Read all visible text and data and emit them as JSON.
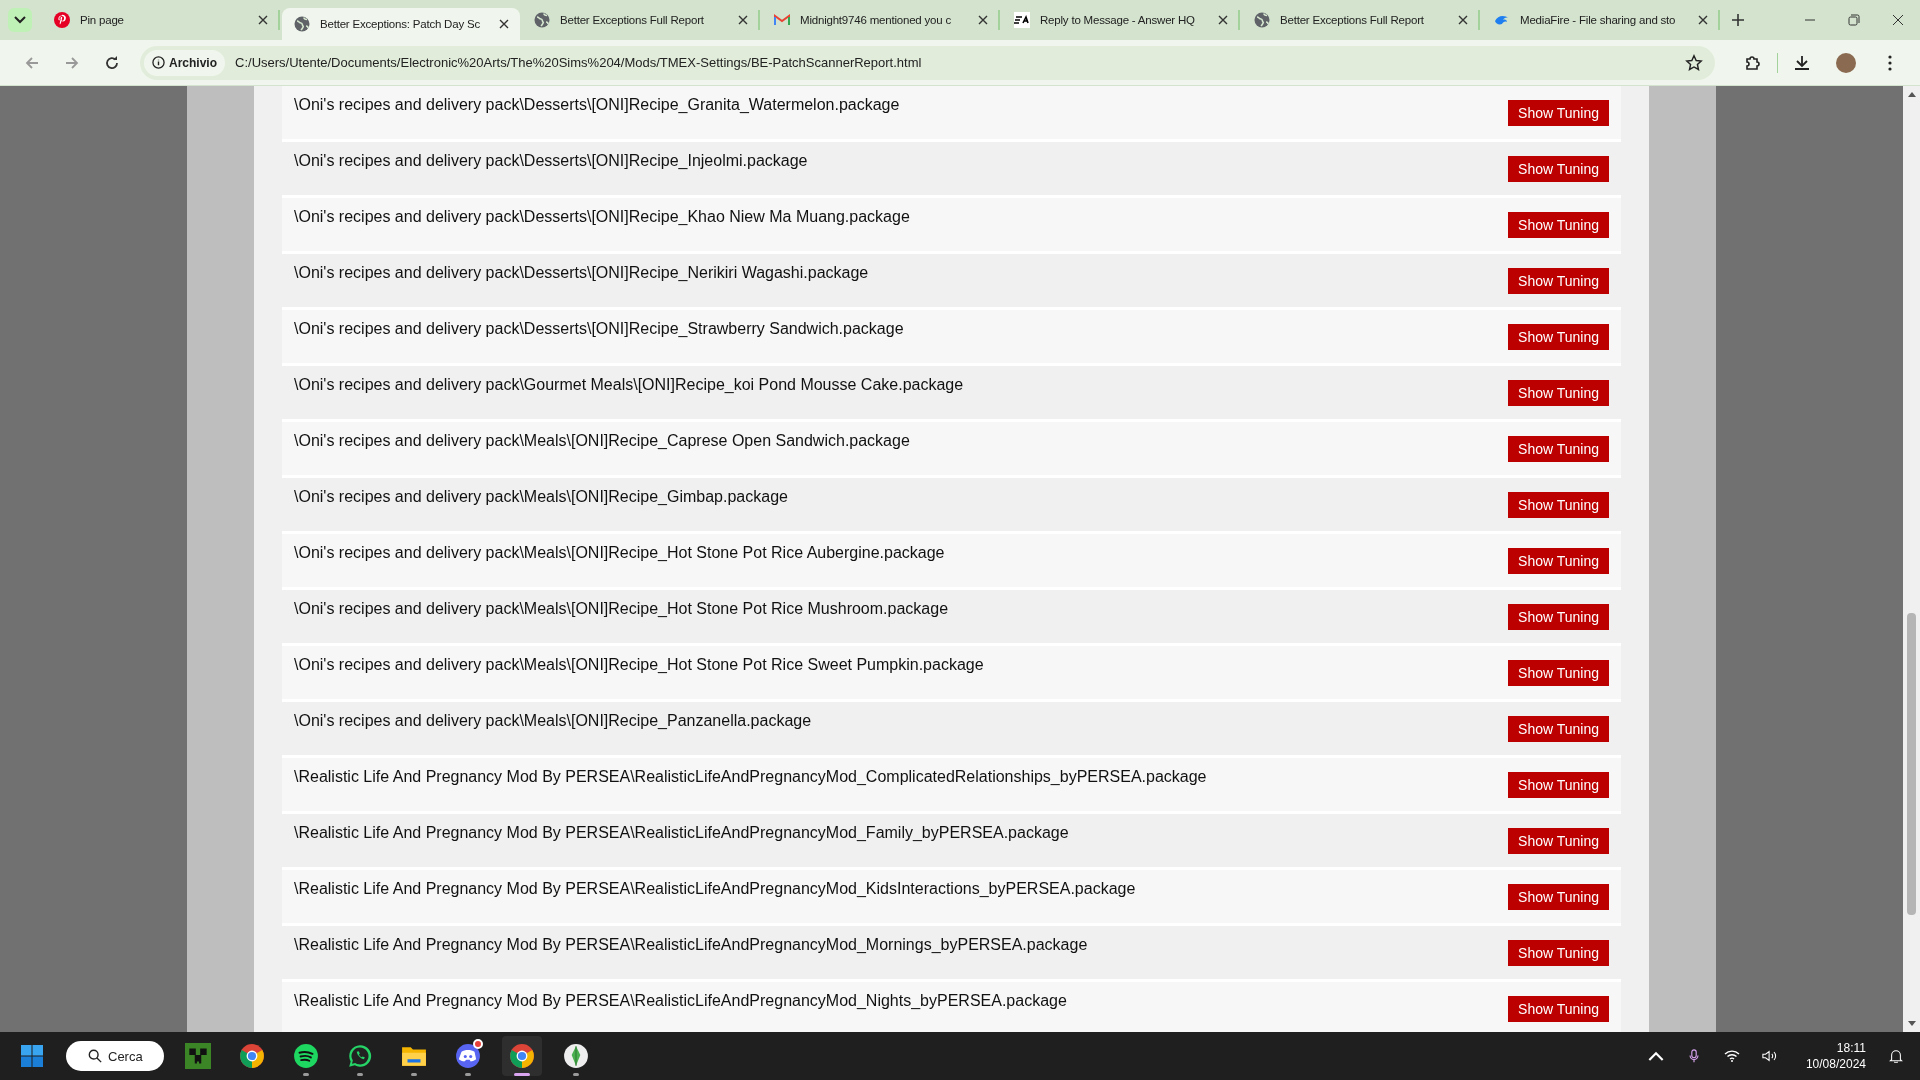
{
  "tabs": [
    {
      "title": "Pin page",
      "selected": false
    },
    {
      "title": "Better Exceptions: Patch Day Sc",
      "selected": true
    },
    {
      "title": "Better Exceptions Full Report",
      "selected": false
    },
    {
      "title": "Midnight9746 mentioned you c",
      "selected": false
    },
    {
      "title": "Reply to Message - Answer HQ",
      "selected": false
    },
    {
      "title": "Better Exceptions Full Report",
      "selected": false
    },
    {
      "title": "MediaFire - File sharing and sto",
      "selected": false
    }
  ],
  "address_bar": {
    "badge": "Archivio",
    "url": "C:/Users/Utente/Documents/Electronic%20Arts/The%20Sims%204/Mods/TMEX-Settings/BE-PatchScannerReport.html"
  },
  "rows": [
    {
      "path": "\\Oni's recipes and delivery pack\\Desserts\\[ONI]Recipe_Granita_Watermelon.package",
      "button": "Show Tuning"
    },
    {
      "path": "\\Oni's recipes and delivery pack\\Desserts\\[ONI]Recipe_Injeolmi.package",
      "button": "Show Tuning"
    },
    {
      "path": "\\Oni's recipes and delivery pack\\Desserts\\[ONI]Recipe_Khao Niew Ma Muang.package",
      "button": "Show Tuning"
    },
    {
      "path": "\\Oni's recipes and delivery pack\\Desserts\\[ONI]Recipe_Nerikiri Wagashi.package",
      "button": "Show Tuning"
    },
    {
      "path": "\\Oni's recipes and delivery pack\\Desserts\\[ONI]Recipe_Strawberry Sandwich.package",
      "button": "Show Tuning"
    },
    {
      "path": "\\Oni's recipes and delivery pack\\Gourmet Meals\\[ONI]Recipe_koi Pond Mousse Cake.package",
      "button": "Show Tuning"
    },
    {
      "path": "\\Oni's recipes and delivery pack\\Meals\\[ONI]Recipe_Caprese Open Sandwich.package",
      "button": "Show Tuning"
    },
    {
      "path": "\\Oni's recipes and delivery pack\\Meals\\[ONI]Recipe_Gimbap.package",
      "button": "Show Tuning"
    },
    {
      "path": "\\Oni's recipes and delivery pack\\Meals\\[ONI]Recipe_Hot Stone Pot Rice Aubergine.package",
      "button": "Show Tuning"
    },
    {
      "path": "\\Oni's recipes and delivery pack\\Meals\\[ONI]Recipe_Hot Stone Pot Rice Mushroom.package",
      "button": "Show Tuning"
    },
    {
      "path": "\\Oni's recipes and delivery pack\\Meals\\[ONI]Recipe_Hot Stone Pot Rice Sweet Pumpkin.package",
      "button": "Show Tuning"
    },
    {
      "path": "\\Oni's recipes and delivery pack\\Meals\\[ONI]Recipe_Panzanella.package",
      "button": "Show Tuning"
    },
    {
      "path": "\\Realistic Life And Pregnancy Mod By PERSEA\\RealisticLifeAndPregnancyMod_ComplicatedRelationships_byPERSEA.package",
      "button": "Show Tuning"
    },
    {
      "path": "\\Realistic Life And Pregnancy Mod By PERSEA\\RealisticLifeAndPregnancyMod_Family_byPERSEA.package",
      "button": "Show Tuning"
    },
    {
      "path": "\\Realistic Life And Pregnancy Mod By PERSEA\\RealisticLifeAndPregnancyMod_KidsInteractions_byPERSEA.package",
      "button": "Show Tuning"
    },
    {
      "path": "\\Realistic Life And Pregnancy Mod By PERSEA\\RealisticLifeAndPregnancyMod_Mornings_byPERSEA.package",
      "button": "Show Tuning"
    },
    {
      "path": "\\Realistic Life And Pregnancy Mod By PERSEA\\RealisticLifeAndPregnancyMod_Nights_byPERSEA.package",
      "button": "Show Tuning"
    }
  ],
  "taskbar": {
    "search": "Cerca",
    "apps": [
      {
        "running": false,
        "notification": false,
        "selected": false
      },
      {
        "running": false,
        "notification": false,
        "selected": false
      },
      {
        "running": true,
        "notification": false,
        "selected": false
      },
      {
        "running": true,
        "notification": false,
        "selected": false
      },
      {
        "running": true,
        "notification": false,
        "selected": false
      },
      {
        "running": true,
        "notification": true,
        "selected": false
      },
      {
        "running": true,
        "notification": false,
        "selected": true
      },
      {
        "running": true,
        "notification": false,
        "selected": false
      }
    ],
    "time": "18:11",
    "date": "10/08/2024"
  }
}
